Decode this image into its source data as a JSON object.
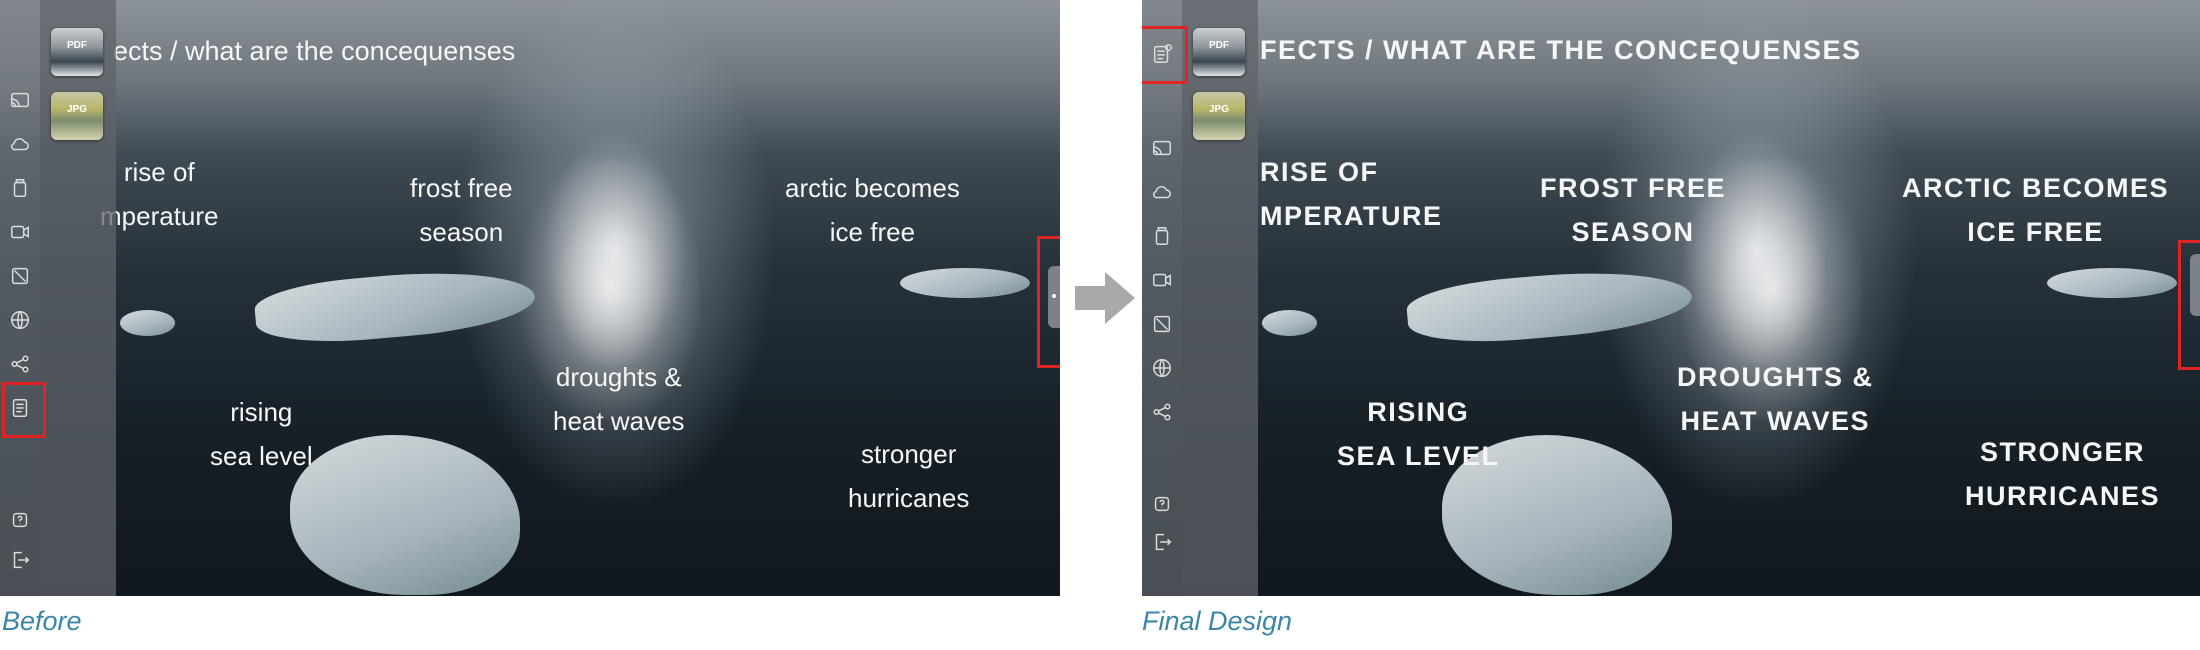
{
  "before": {
    "caption": "Before",
    "title": "ects / what are the concequenses",
    "thumbnails": [
      {
        "label": "PDF",
        "icon": "pdf-thumbnail"
      },
      {
        "label": "JPG",
        "icon": "jpg-thumbnail"
      }
    ],
    "sidebar_icons": [
      "cast-icon",
      "cloud-icon",
      "jar-icon",
      "video-icon",
      "diagonal-icon",
      "globe-icon",
      "share-icon",
      "document-icon",
      "help-icon",
      "exit-icon"
    ],
    "phrases": {
      "rise": [
        "rise of",
        "mperature"
      ],
      "frost": [
        "frost free",
        "season"
      ],
      "arctic": [
        "arctic becomes",
        "ice free"
      ],
      "droughts": [
        "droughts &",
        "heat waves"
      ],
      "sea": [
        "rising",
        "sea level"
      ],
      "storms": [
        "stronger",
        "hurricanes"
      ]
    }
  },
  "after": {
    "caption": "Final Design",
    "title": "fects / what are the concequenses",
    "thumbnails": [
      {
        "label": "PDF",
        "icon": "pdf-thumbnail"
      },
      {
        "label": "JPG",
        "icon": "jpg-thumbnail"
      }
    ],
    "sidebar_icons": [
      "document-notification-icon",
      "cast-icon",
      "cloud-icon",
      "jar-icon",
      "video-icon",
      "diagonal-icon",
      "globe-icon",
      "share-icon",
      "help-icon",
      "exit-icon"
    ],
    "phrases": {
      "rise": [
        "rise of",
        "mperature"
      ],
      "frost": [
        "frost free",
        "season"
      ],
      "arctic": [
        "arctic becomes",
        "ice free"
      ],
      "droughts": [
        "droughts &",
        "heat waves"
      ],
      "sea": [
        "rising",
        "sea level"
      ],
      "storms": [
        "stronger",
        "hurricanes"
      ]
    }
  },
  "colors": {
    "highlight": "#e02424",
    "caption": "#3b86a8",
    "arrow": "#a9a9a9"
  }
}
